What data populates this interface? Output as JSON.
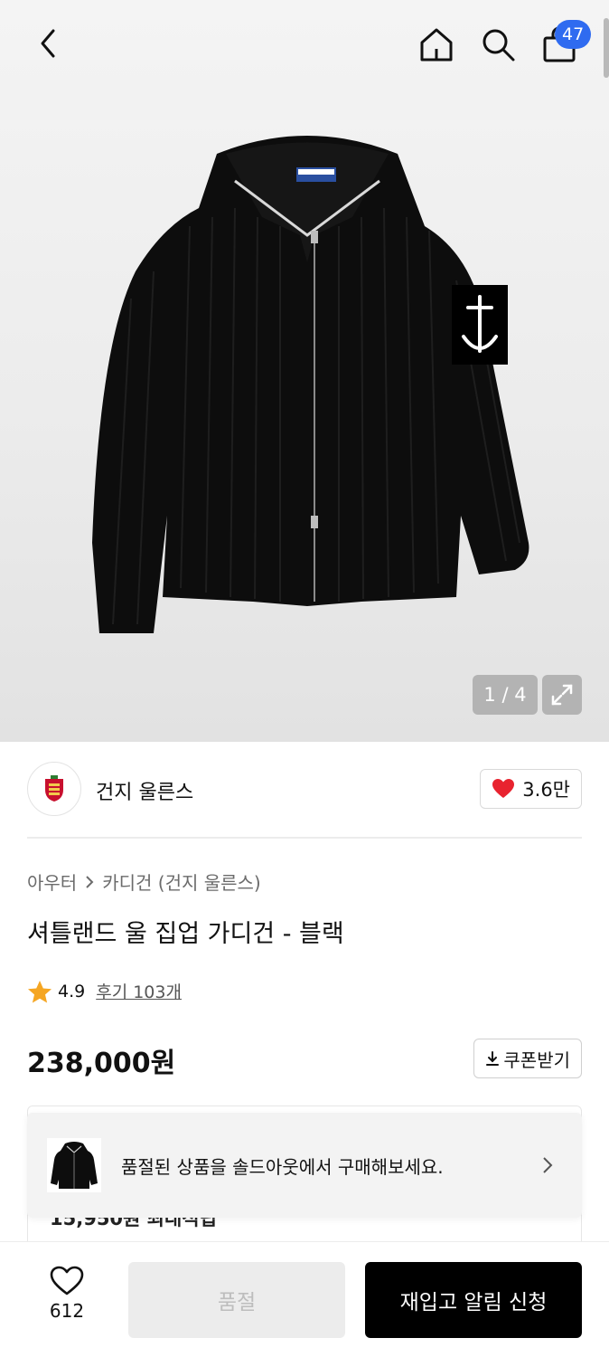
{
  "header": {
    "cart_count": "47"
  },
  "gallery": {
    "pager": "1 / 4",
    "current_index": 1,
    "total": 4
  },
  "brand": {
    "name": "건지 울른스",
    "likes": "3.6만"
  },
  "product": {
    "breadcrumb": [
      "아우터",
      "카디건 (건지 울른스)"
    ],
    "title": "셔틀랜드 울 집업 가디건 - 블랙",
    "rating": "4.9",
    "reviews": "후기 103개",
    "price": "238,000원",
    "coupon_label": "쿠폰받기"
  },
  "info_card": {
    "partial_text": "15,950원 최대적립"
  },
  "toast": {
    "message": "품절된 상품을 솔드아웃에서 구매해보세요."
  },
  "bottom": {
    "wish_count": "612",
    "soldout_label": "품절",
    "restock_label": "재입고 알림 신청"
  },
  "colors": {
    "badge": "#2f6bf0",
    "heart": "#e8232f",
    "star": "#f5a623",
    "primary_button": "#000000"
  }
}
